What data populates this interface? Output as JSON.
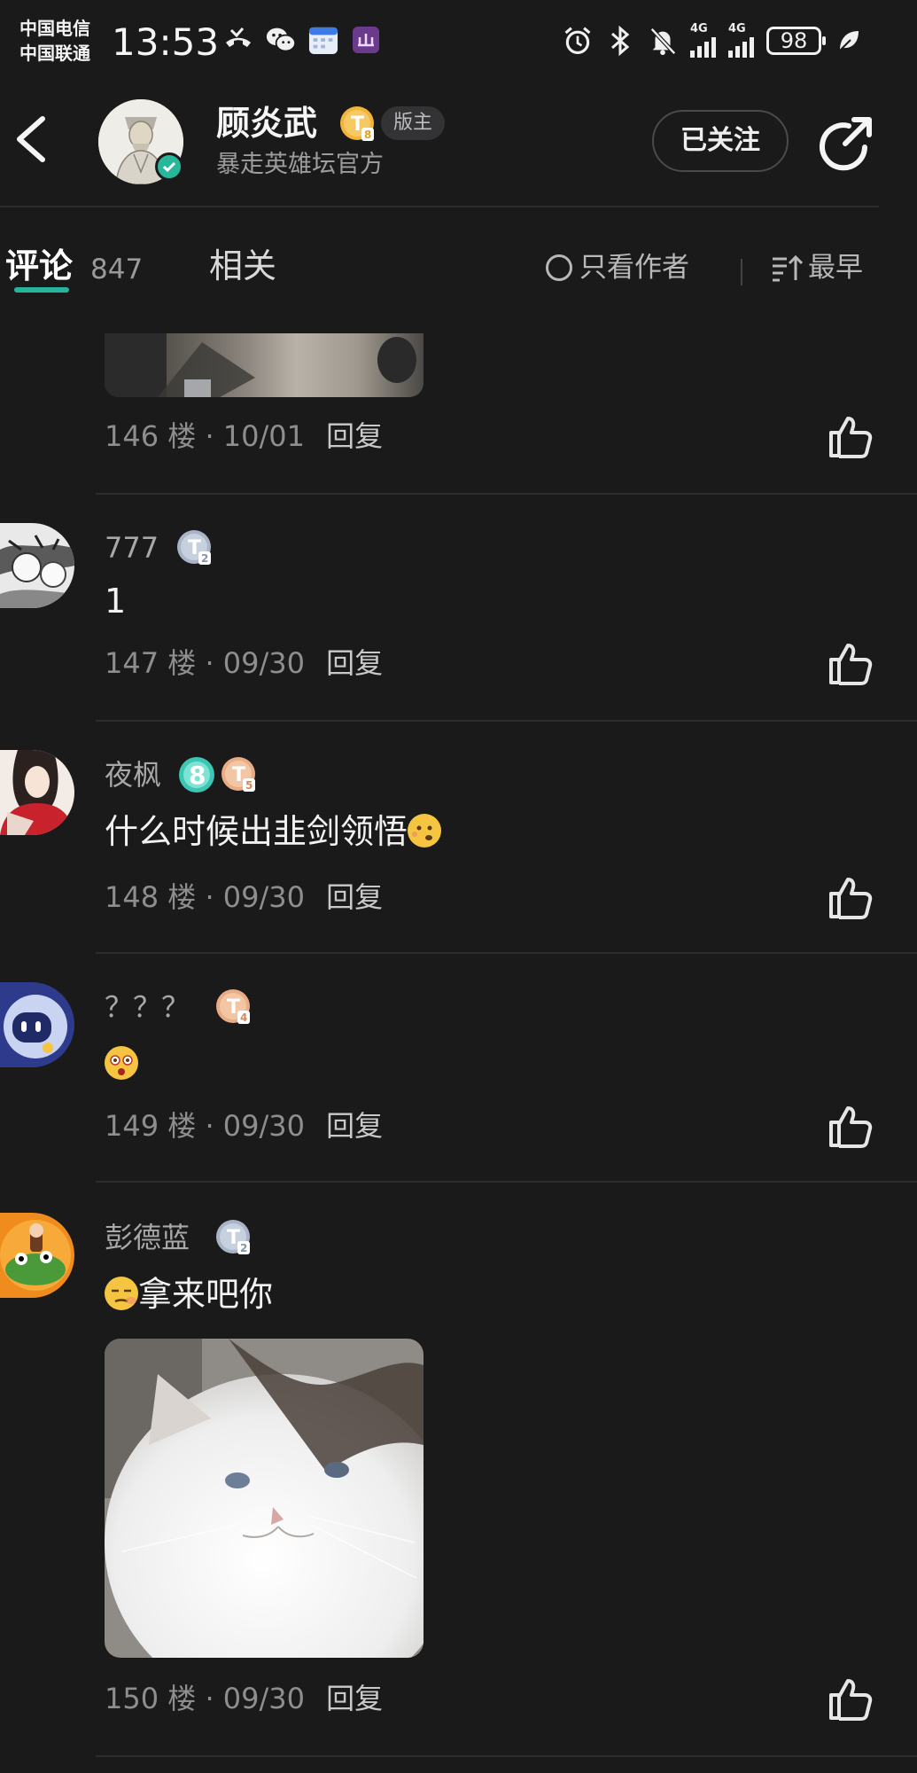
{
  "status_bar": {
    "carrier_1": "中国电信",
    "carrier_2": "中国联通",
    "time": "13:53",
    "network_1": "4G",
    "network_2": "4G",
    "battery": "98"
  },
  "header": {
    "author_name": "顾炎武",
    "level_badge": "T8",
    "role_badge": "版主",
    "subtitle": "暴走英雄坛官方",
    "follow_button": "已关注"
  },
  "tabs": {
    "comments_label": "评论",
    "comments_count": "847",
    "related_label": "相关",
    "only_author": "只看作者",
    "sort_label": "最早"
  },
  "comments": [
    {
      "floor": "146 楼",
      "date": "10/01",
      "reply": "回复"
    },
    {
      "username": "777",
      "badge": "T2",
      "text": "1",
      "floor": "147 楼",
      "date": "09/30",
      "reply": "回复"
    },
    {
      "username": "夜枫",
      "badge": "T5",
      "extra_badge": "8",
      "text": "什么时候出韭剑领悟",
      "floor": "148 楼",
      "date": "09/30",
      "reply": "回复"
    },
    {
      "username": "？？？",
      "badge": "T4",
      "text": "",
      "floor": "149 楼",
      "date": "09/30",
      "reply": "回复"
    },
    {
      "username": "彭德蓝",
      "badge": "T2",
      "text": "拿来吧你",
      "floor": "150 楼",
      "date": "09/30",
      "reply": "回复"
    }
  ],
  "colors": {
    "background": "#1a1a1b",
    "accent": "#26b59a",
    "gold_badge": "#f2b53a",
    "silver_badge": "#a9b4c6",
    "bronze_badge": "#e8ad85"
  }
}
